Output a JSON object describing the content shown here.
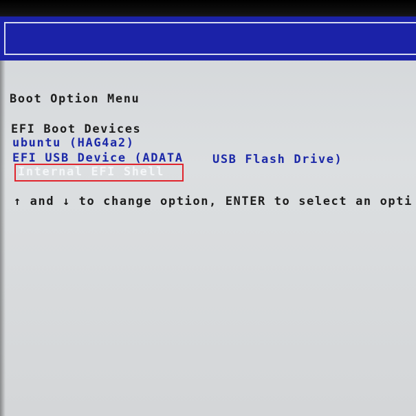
{
  "menu": {
    "title": "Boot Option Menu",
    "group_title": "EFI Boot Devices",
    "options": [
      {
        "label": "ubuntu (HAG4a2)"
      },
      {
        "label": "EFI USB Device (ADATA",
        "label_tail": "USB Flash Drive)"
      },
      {
        "label": "Internal EFI Shell",
        "selected": true
      }
    ],
    "hint": "↑ and ↓ to change option, ENTER to select an opti"
  },
  "colors": {
    "title_bar": "#1b22a8",
    "option_text": "#1c29a8",
    "background": "#d8dadc",
    "highlight_box": "#e0232b"
  }
}
